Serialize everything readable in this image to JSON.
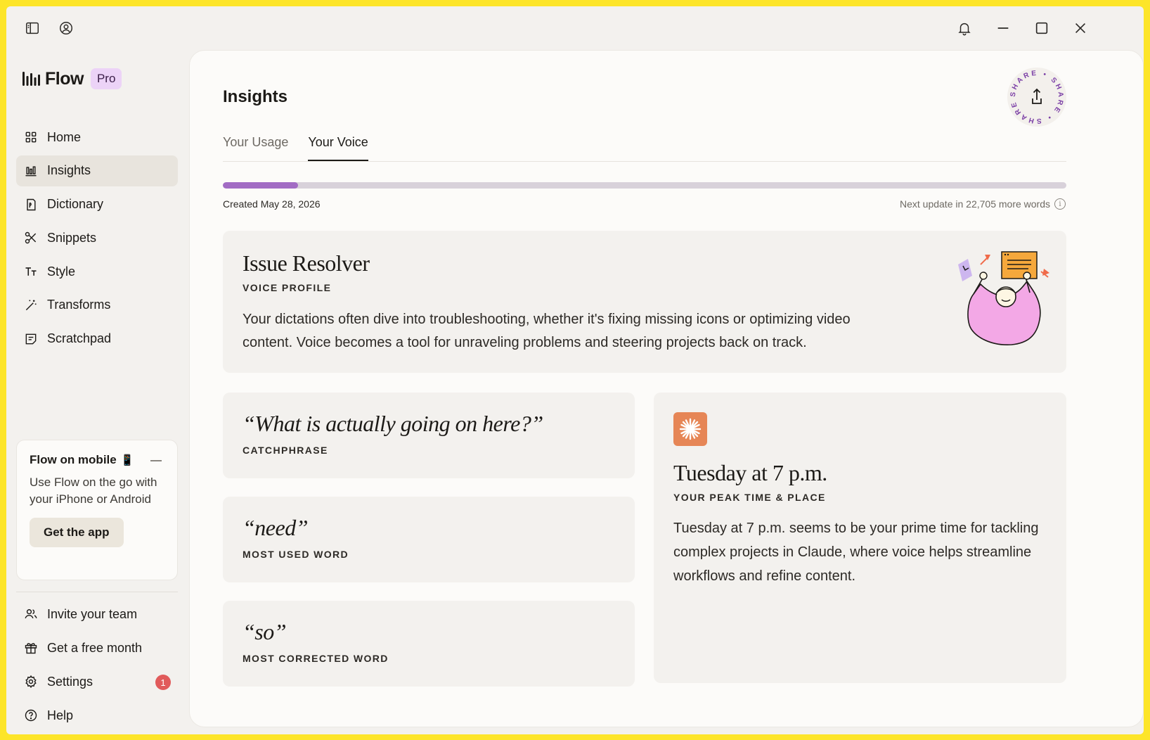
{
  "titlebar": {
    "left_icons": [
      "sidebar-toggle-icon",
      "account-icon"
    ],
    "right_icons": [
      "bell-icon",
      "minimize-icon",
      "maximize-icon",
      "close-icon"
    ]
  },
  "brand": {
    "name": "Flow",
    "badge": "Pro"
  },
  "nav": {
    "items": [
      {
        "label": "Home",
        "icon": "grid-icon"
      },
      {
        "label": "Insights",
        "icon": "bar-chart-icon",
        "active": true
      },
      {
        "label": "Dictionary",
        "icon": "book-icon"
      },
      {
        "label": "Snippets",
        "icon": "scissors-icon"
      },
      {
        "label": "Style",
        "icon": "text-style-icon"
      },
      {
        "label": "Transforms",
        "icon": "magic-wand-icon"
      },
      {
        "label": "Scratchpad",
        "icon": "notepad-icon"
      }
    ]
  },
  "mobile_card": {
    "title": "Flow on mobile",
    "emoji": "📱",
    "text": "Use Flow on the go with your iPhone or Android",
    "button": "Get the app"
  },
  "bottom_nav": {
    "items": [
      {
        "label": "Invite your team",
        "icon": "users-icon"
      },
      {
        "label": "Get a free month",
        "icon": "gift-icon"
      },
      {
        "label": "Settings",
        "icon": "gear-icon",
        "badge": "1"
      },
      {
        "label": "Help",
        "icon": "help-icon"
      }
    ]
  },
  "main": {
    "title": "Insights",
    "share_text": "SHARE • SHARE • SHARE •",
    "tabs": [
      {
        "label": "Your Usage"
      },
      {
        "label": "Your Voice",
        "active": true
      }
    ],
    "progress_fraction": 0.089,
    "created": "Created May 28, 2026",
    "next_update": "Next update in 22,705 more words",
    "profile": {
      "title": "Issue Resolver",
      "label": "VOICE PROFILE",
      "description": "Your dictations often dive into troubleshooting, whether it's fixing missing icons or optimizing video content. Voice becomes a tool for unraveling problems and steering projects back on track."
    },
    "catchphrase": {
      "value": "“What is actually going on here?”",
      "label": "CATCHPHRASE"
    },
    "most_used": {
      "value": "“need”",
      "label": "MOST USED WORD"
    },
    "most_corrected": {
      "value": "“so”",
      "label": "MOST CORRECTED WORD"
    },
    "peak": {
      "title": "Tuesday at 7 p.m.",
      "label": "YOUR PEAK TIME & PLACE",
      "description": "Tuesday at 7 p.m. seems to be your prime time for tackling complex projects in Claude, where voice helps streamline workflows and refine content."
    }
  },
  "colors": {
    "background_frame": "#fde529",
    "accent_purple": "#a26cc4",
    "pro_badge": "#ecd3f7",
    "peak_icon": "#e68656",
    "badge_red": "#e15b5b"
  }
}
